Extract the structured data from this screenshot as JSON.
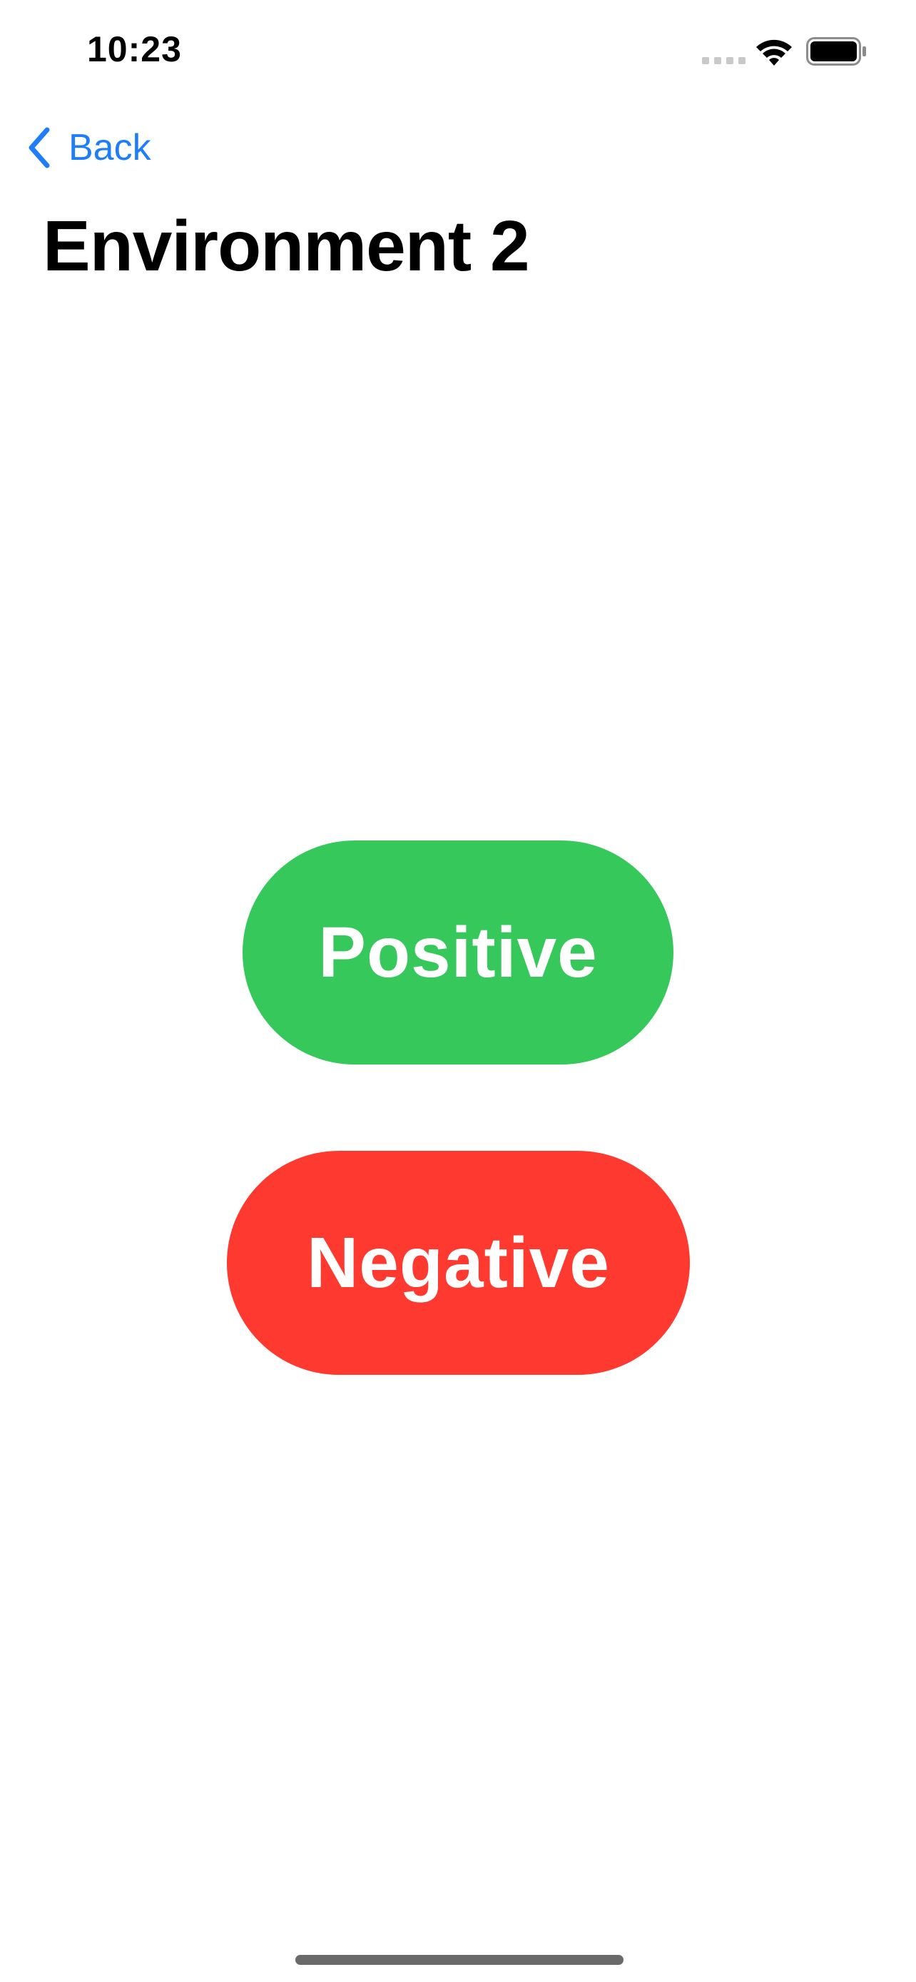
{
  "status_bar": {
    "time": "10:23",
    "icons": [
      "signal-dots-icon",
      "wifi-icon",
      "battery-icon"
    ]
  },
  "nav": {
    "back_label": "Back",
    "back_icon": "chevron-left-icon",
    "accent_color": "#1f7ef7"
  },
  "page": {
    "title": "Environment 2"
  },
  "buttons": {
    "positive_label": "Positive",
    "positive_color": "#37c85b",
    "negative_label": "Negative",
    "negative_color": "#fe3a30"
  }
}
